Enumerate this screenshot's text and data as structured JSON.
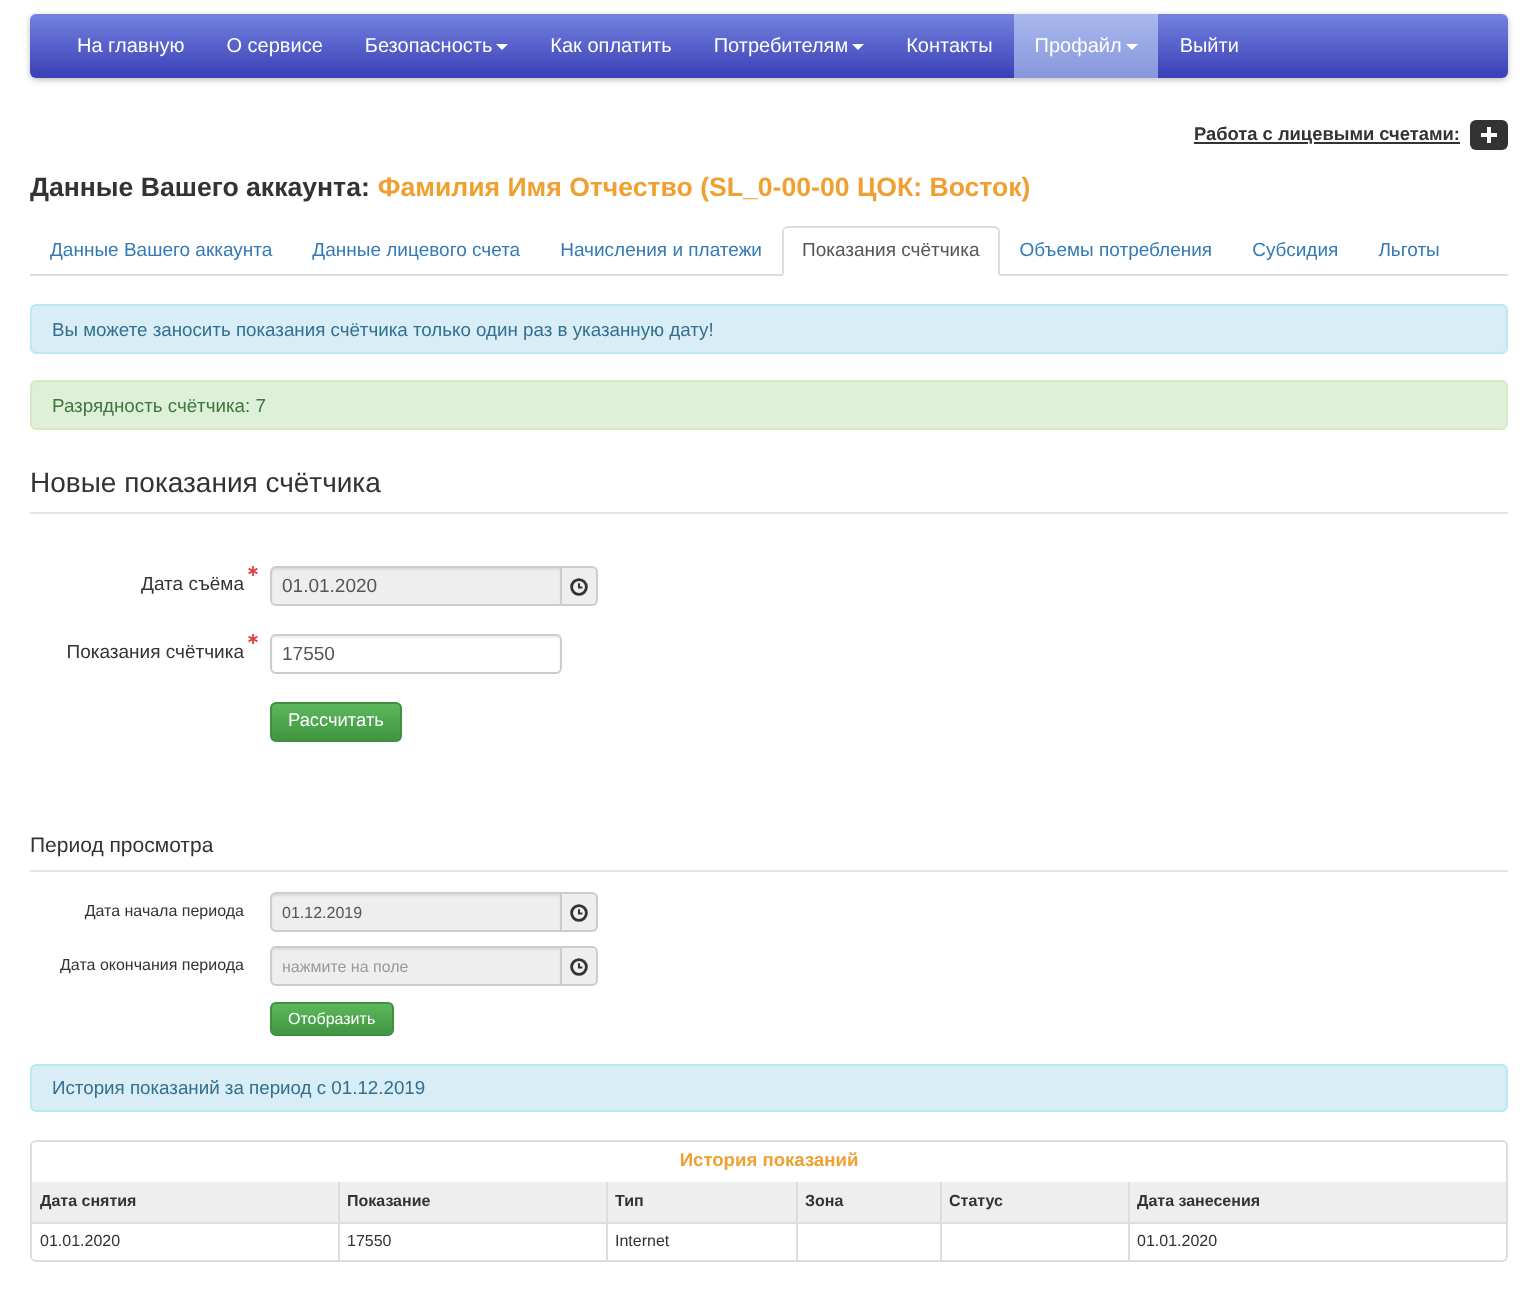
{
  "navbar": {
    "items": [
      {
        "label": "На главную",
        "dropdown": false,
        "selected": false
      },
      {
        "label": "О сервисе",
        "dropdown": false,
        "selected": false
      },
      {
        "label": "Безопасность",
        "dropdown": true,
        "selected": false
      },
      {
        "label": "Как оплатить",
        "dropdown": false,
        "selected": false
      },
      {
        "label": "Потребителям",
        "dropdown": true,
        "selected": false
      },
      {
        "label": "Контакты",
        "dropdown": false,
        "selected": false
      },
      {
        "label": "Профайл",
        "dropdown": true,
        "selected": true
      },
      {
        "label": "Выйти",
        "dropdown": false,
        "selected": false
      }
    ]
  },
  "accounts_link": {
    "label": "Работа с лицевыми счетами:"
  },
  "heading": {
    "label": "Данные Вашего аккаунта:",
    "account": "Фамилия Имя Отчество (SL_0-00-00 ЦОК: Восток)"
  },
  "tabs": [
    {
      "label": "Данные Вашего аккаунта",
      "selected": false
    },
    {
      "label": "Данные лицевого счета",
      "selected": false
    },
    {
      "label": "Начисления и платежи",
      "selected": false
    },
    {
      "label": "Показания счётчика",
      "selected": true
    },
    {
      "label": "Объемы потребления",
      "selected": false
    },
    {
      "label": "Субсидия",
      "selected": false
    },
    {
      "label": "Льготы",
      "selected": false
    }
  ],
  "alerts": [
    {
      "kind": "info",
      "text": "Вы можете заносить показания счётчика только один раз в указанную дату!"
    },
    {
      "kind": "success",
      "text": "Разрядность счётчика: 7"
    }
  ],
  "new_reading": {
    "title": "Новые показания счётчика",
    "fields": [
      {
        "label": "Дата съёма",
        "required": true,
        "kind": "date",
        "readonly": true,
        "value": "01.01.2020"
      },
      {
        "label": "Показания счётчика",
        "required": true,
        "kind": "text",
        "readonly": false,
        "value": "17550"
      }
    ],
    "button": "Рассчитать"
  },
  "period": {
    "title": "Период просмотра",
    "fields": [
      {
        "label": "Дата начала периода",
        "kind": "date",
        "readonly": true,
        "value": "01.12.2019"
      },
      {
        "label": "Дата окончания периода",
        "kind": "date",
        "readonly": true,
        "placeholder": "нажмите на поле"
      }
    ],
    "button": "Отобразить"
  },
  "history_alert": {
    "kind": "info",
    "text": "История показаний за период с 01.12.2019"
  },
  "history_table": {
    "title": "История показаний",
    "columns": [
      "Дата снятия",
      "Показание",
      "Тип",
      "Зона",
      "Статус",
      "Дата занесения"
    ],
    "rows": [
      [
        "01.01.2020",
        "17550",
        "Internet",
        null,
        null,
        "01.01.2020"
      ]
    ]
  }
}
